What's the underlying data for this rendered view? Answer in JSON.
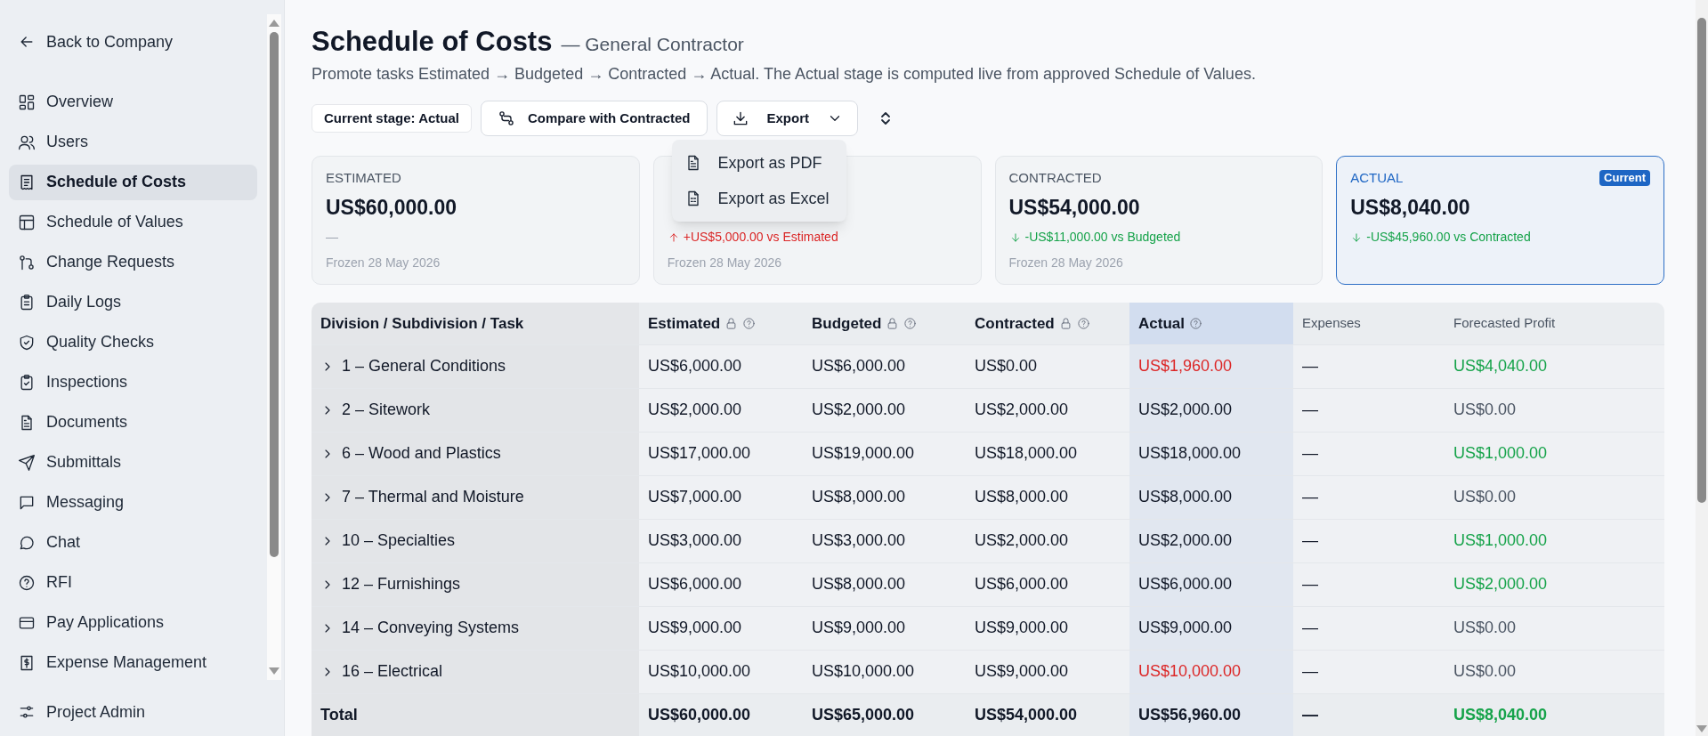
{
  "sidebar": {
    "back_link": "Back to Company",
    "items": [
      {
        "label": "Overview",
        "selected": false
      },
      {
        "label": "Users",
        "selected": false
      },
      {
        "label": "Schedule of Costs",
        "selected": true
      },
      {
        "label": "Schedule of Values",
        "selected": false
      },
      {
        "label": "Change Requests",
        "selected": false
      },
      {
        "label": "Daily Logs",
        "selected": false
      },
      {
        "label": "Quality Checks",
        "selected": false
      },
      {
        "label": "Inspections",
        "selected": false
      },
      {
        "label": "Documents",
        "selected": false
      },
      {
        "label": "Submittals",
        "selected": false
      },
      {
        "label": "Messaging",
        "selected": false
      },
      {
        "label": "Chat",
        "selected": false
      },
      {
        "label": "RFI",
        "selected": false
      },
      {
        "label": "Pay Applications",
        "selected": false
      },
      {
        "label": "Expense Management",
        "selected": false
      }
    ],
    "footer_item": "Project Admin"
  },
  "header": {
    "title": "Schedule of Costs",
    "subtitle": "— General Contractor",
    "description": "Promote tasks Estimated → Budgeted → Contracted → Actual. The Actual stage is computed live from approved Schedule of Values."
  },
  "toolbar": {
    "stage_badge": "Current stage: Actual",
    "compare_button": "Compare with Contracted",
    "export_button": "Export",
    "export_menu": {
      "expanded": true,
      "items": [
        "Export as PDF",
        "Export as Excel"
      ]
    }
  },
  "cards": [
    {
      "label": "ESTIMATED",
      "amount": "US$60,000.00",
      "delta": "—",
      "kind": "flat",
      "frozen": "Frozen 28 May 2026",
      "selected": false
    },
    {
      "delta": "+US$5,000.00 vs Estimated",
      "kind": "up",
      "frozen": "Frozen 28 May 2026",
      "selected": false
    },
    {
      "label": "CONTRACTED",
      "amount": "US$54,000.00",
      "delta": "-US$11,000.00 vs Budgeted",
      "kind": "down",
      "frozen": "Frozen 28 May 2026",
      "selected": false
    },
    {
      "label": "ACTUAL",
      "amount": "US$8,040.00",
      "delta": "-US$45,960.00 vs Contracted",
      "kind": "down",
      "badge": "Current",
      "selected": true
    }
  ],
  "table": {
    "columns": [
      {
        "label": "Division / Subdivision / Task",
        "kind": "stage",
        "locked": false,
        "help": false,
        "selected": false
      },
      {
        "label": "Estimated",
        "kind": "stage",
        "locked": true,
        "help": true,
        "selected": false
      },
      {
        "label": "Budgeted",
        "kind": "stage",
        "locked": true,
        "help": true,
        "selected": false
      },
      {
        "label": "Contracted",
        "kind": "stage",
        "locked": true,
        "help": true,
        "selected": false
      },
      {
        "label": "Actual",
        "kind": "stage",
        "locked": false,
        "help": true,
        "selected": true
      },
      {
        "label": "Expenses",
        "kind": "derived",
        "locked": false,
        "help": false,
        "selected": false
      },
      {
        "label": "Forecasted Profit",
        "kind": "derived",
        "locked": false,
        "help": false,
        "selected": false
      }
    ],
    "rows": [
      {
        "expanded": false,
        "cells": [
          {
            "text": "1 – General Conditions"
          },
          {
            "text": "US$6,000.00"
          },
          {
            "text": "US$6,000.00"
          },
          {
            "text": "US$0.00"
          },
          {
            "text": "US$1,960.00",
            "color": "#dc2626"
          },
          {
            "text": "—"
          },
          {
            "text": "US$4,040.00",
            "color": "#16a34a"
          }
        ]
      },
      {
        "expanded": false,
        "cells": [
          {
            "text": "2 – Sitework"
          },
          {
            "text": "US$2,000.00"
          },
          {
            "text": "US$2,000.00"
          },
          {
            "text": "US$2,000.00"
          },
          {
            "text": "US$2,000.00"
          },
          {
            "text": "—"
          },
          {
            "text": "US$0.00",
            "color": "#4b5563"
          }
        ]
      },
      {
        "expanded": false,
        "cells": [
          {
            "text": "6 – Wood and Plastics"
          },
          {
            "text": "US$17,000.00"
          },
          {
            "text": "US$19,000.00"
          },
          {
            "text": "US$18,000.00"
          },
          {
            "text": "US$18,000.00"
          },
          {
            "text": "—"
          },
          {
            "text": "US$1,000.00",
            "color": "#16a34a"
          }
        ]
      },
      {
        "expanded": false,
        "cells": [
          {
            "text": "7 – Thermal and Moisture"
          },
          {
            "text": "US$7,000.00"
          },
          {
            "text": "US$8,000.00"
          },
          {
            "text": "US$8,000.00"
          },
          {
            "text": "US$8,000.00"
          },
          {
            "text": "—"
          },
          {
            "text": "US$0.00",
            "color": "#4b5563"
          }
        ]
      },
      {
        "expanded": false,
        "cells": [
          {
            "text": "10 – Specialties"
          },
          {
            "text": "US$3,000.00"
          },
          {
            "text": "US$3,000.00"
          },
          {
            "text": "US$2,000.00"
          },
          {
            "text": "US$2,000.00"
          },
          {
            "text": "—"
          },
          {
            "text": "US$1,000.00",
            "color": "#16a34a"
          }
        ]
      },
      {
        "expanded": false,
        "cells": [
          {
            "text": "12 – Furnishings"
          },
          {
            "text": "US$6,000.00"
          },
          {
            "text": "US$8,000.00"
          },
          {
            "text": "US$6,000.00"
          },
          {
            "text": "US$6,000.00"
          },
          {
            "text": "—"
          },
          {
            "text": "US$2,000.00",
            "color": "#16a34a"
          }
        ]
      },
      {
        "expanded": false,
        "cells": [
          {
            "text": "14 – Conveying Systems"
          },
          {
            "text": "US$9,000.00"
          },
          {
            "text": "US$9,000.00"
          },
          {
            "text": "US$9,000.00"
          },
          {
            "text": "US$9,000.00"
          },
          {
            "text": "—"
          },
          {
            "text": "US$0.00",
            "color": "#4b5563"
          }
        ]
      },
      {
        "expanded": false,
        "cells": [
          {
            "text": "16 – Electrical"
          },
          {
            "text": "US$10,000.00"
          },
          {
            "text": "US$10,000.00"
          },
          {
            "text": "US$9,000.00"
          },
          {
            "text": "US$10,000.00",
            "color": "#dc2626"
          },
          {
            "text": "—"
          },
          {
            "text": "US$0.00",
            "color": "#4b5563"
          }
        ]
      }
    ],
    "total": {
      "cells": [
        {
          "text": "Total"
        },
        {
          "text": "US$60,000.00"
        },
        {
          "text": "US$65,000.00"
        },
        {
          "text": "US$54,000.00"
        },
        {
          "text": "US$56,960.00"
        },
        {
          "text": "—"
        },
        {
          "text": "US$8,040.00",
          "color": "#16a34a"
        }
      ]
    }
  }
}
